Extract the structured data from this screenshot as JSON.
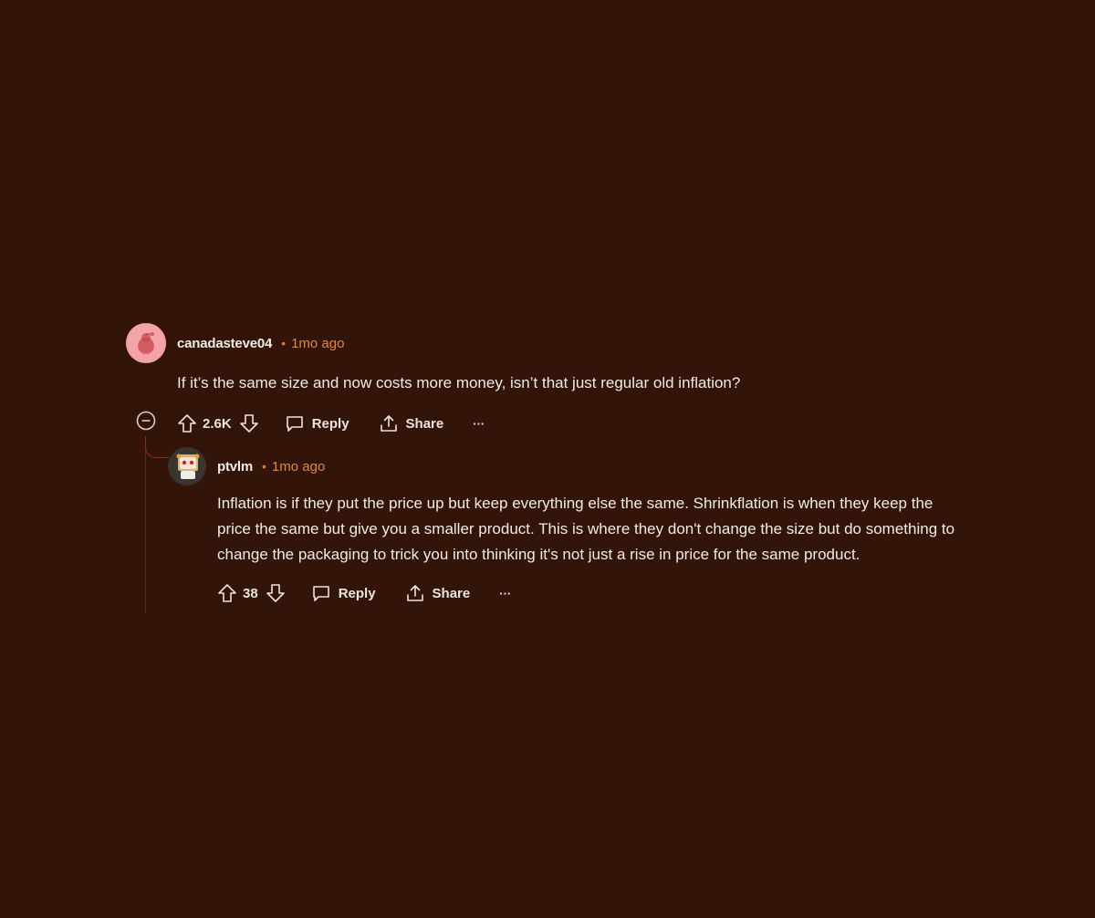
{
  "comment": {
    "username": "canadasteve04",
    "separator": "•",
    "time": "1mo ago",
    "body": "If it’s the same size and now costs more money, isn’t that just regular old inflation?",
    "votes": "2.6K",
    "reply_label": "Reply",
    "share_label": "Share",
    "more_label": "···"
  },
  "reply": {
    "username": "ptvlm",
    "separator": "•",
    "time": "1mo ago",
    "body_line1": "Inflation is if they put the price up but keep everything else the same. Shrinkflation is when they keep the",
    "body_line2": "price the same but give you a smaller product. This is where they don't change the size but do something to",
    "body_line3": "change the packaging to trick you into thinking it's not just a rise in price for the same product.",
    "votes": "38",
    "reply_label": "Reply",
    "share_label": "Share",
    "more_label": "···"
  },
  "colors": {
    "background": "#331408",
    "timestamp": "#e0893a",
    "text": "#f1ebe7",
    "avatar_root": "#f4a4a8"
  }
}
